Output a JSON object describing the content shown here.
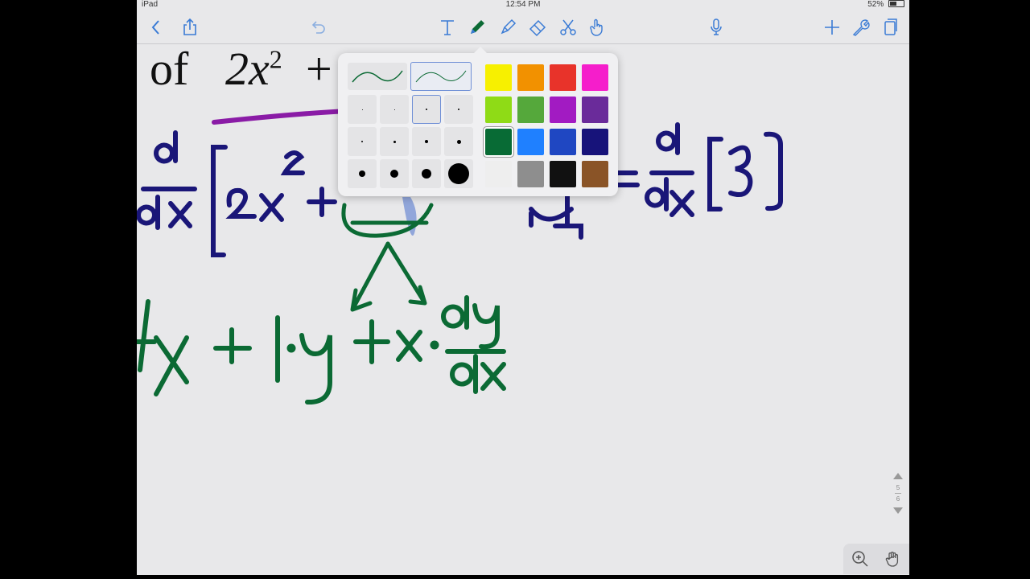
{
  "status": {
    "device": "iPad",
    "time": "12:54 PM",
    "battery": "52%",
    "battery_fraction": 0.52
  },
  "toolbar": {
    "left": [
      {
        "icon": "chevron-left-icon"
      },
      {
        "icon": "share-icon"
      },
      {
        "icon": "undo-icon"
      }
    ],
    "center": [
      {
        "icon": "text-tool-icon"
      },
      {
        "icon": "pen-tool-icon",
        "selected": true
      },
      {
        "icon": "highlighter-icon"
      },
      {
        "icon": "eraser-icon"
      },
      {
        "icon": "scissors-icon"
      },
      {
        "icon": "hand-pointer-icon"
      }
    ],
    "right": [
      {
        "icon": "microphone-icon"
      },
      {
        "icon": "plus-icon"
      },
      {
        "icon": "wrench-icon"
      },
      {
        "icon": "pages-icon"
      }
    ]
  },
  "document": {
    "typed_word": "of",
    "typed_term": "2x",
    "typed_exponent": "2",
    "typed_plus": "+",
    "ink_colors": {
      "navy": "#1a1678",
      "green": "#0b6a34",
      "purple": "#8a1ba6",
      "highlight": "#3a63c9"
    }
  },
  "pen_popover": {
    "pen_styles": [
      {
        "name": "smooth"
      },
      {
        "name": "fountain",
        "selected": true
      }
    ],
    "colors": [
      "#f7f000",
      "#f29100",
      "#e8332a",
      "#f51ecb",
      "#8fdb16",
      "#55a83b",
      "#a21bc2",
      "#6a2b9a",
      "#086b35",
      "#1f80ff",
      "#1f47c2",
      "#17137a",
      "#eeeeee",
      "#8e8e8e",
      "#111111",
      "#8a5427"
    ],
    "selected_color_index": 8
  },
  "page_indicator": {
    "current": "5",
    "total": "6"
  },
  "bottom_tools": [
    {
      "icon": "zoom-in-icon"
    },
    {
      "icon": "hand-pan-icon"
    }
  ]
}
